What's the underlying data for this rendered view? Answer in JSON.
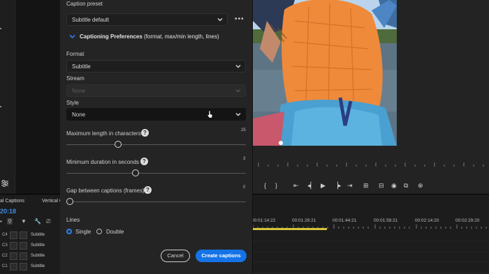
{
  "dialog": {
    "caption_preset_label": "Caption preset",
    "caption_preset_value": "Subtitle default",
    "more_label": "•••",
    "section_title": "Captioning Preferences",
    "section_subtitle": "(format, max/min length, lines)",
    "format_label": "Format",
    "format_value": "Subtitle",
    "stream_label": "Stream",
    "stream_value": "None",
    "style_label": "Style",
    "style_value": "None",
    "max_length_label": "Maximum length in characters",
    "max_length_value": "25",
    "max_length_fraction": 0.28,
    "min_duration_label": "Minimum duration in seconds",
    "min_duration_value": "3",
    "min_duration_fraction": 0.38,
    "gap_label": "Gap between captions (frames)",
    "gap_value": "0",
    "gap_fraction": 0.0,
    "help_glyph": "?",
    "lines_label": "Lines",
    "lines_single": "Single",
    "lines_double": "Double",
    "lines_selected": "Single",
    "cancel_label": "Cancel",
    "create_label": "Create captions"
  },
  "timeline": {
    "tab_captions": "al Captions",
    "tab_vertical": "Vertical C",
    "timecode": "20:18",
    "ruler_times": [
      "00:01:14:22",
      "00:01:29:21",
      "00:01:44:21",
      "00:01:59:21",
      "00:02:14:20",
      "00:02:29:20"
    ],
    "tracks": [
      {
        "id": "C4",
        "label": "Subtitle"
      },
      {
        "id": "C3",
        "label": "Subtitle"
      },
      {
        "id": "C2",
        "label": "Subtitle"
      },
      {
        "id": "C1",
        "label": "Subtitle"
      }
    ]
  },
  "colors": {
    "accent": "#1473e6",
    "timecode": "#3d8ee8",
    "playhead_range": "#d8c43a"
  }
}
